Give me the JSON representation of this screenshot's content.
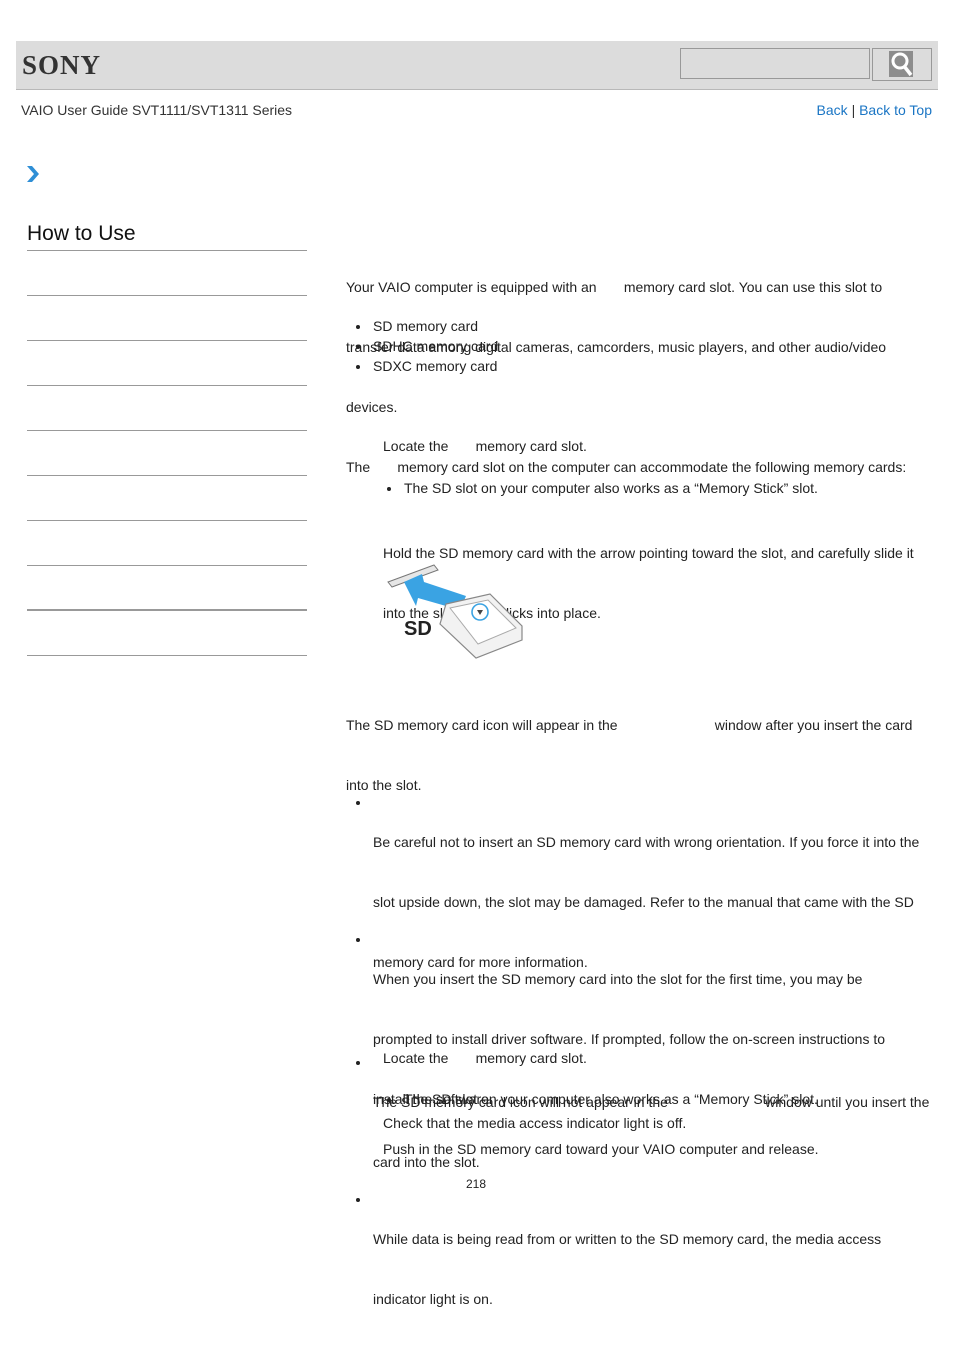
{
  "header": {
    "logo": "SONY",
    "search_placeholder": "",
    "search_icon": "search-icon"
  },
  "subheader": {
    "title": "VAIO User Guide SVT1111/SVT1311 Series",
    "back_label": "Back",
    "separator": "|",
    "back_to_top_label": "Back to Top"
  },
  "breadcrumb": {
    "icon": "chevron-right-icon"
  },
  "sidebar": {
    "heading": "How to Use",
    "items": [
      "",
      "",
      "",
      "",
      "",
      "",
      "",
      "",
      ""
    ]
  },
  "content": {
    "intro_line1": "Your VAIO computer is equipped with an       memory card slot. You can use this slot to",
    "intro_line2": "transfer data among digital cameras, camcorders, music players, and other audio/video",
    "intro_line3": "devices.",
    "slot_line": "The       memory card slot on the computer can accommodate the following memory cards:",
    "card_types": [
      "SD memory card",
      "SDHC memory card",
      "SDXC memory card"
    ],
    "insert_steps": {
      "step1": "Locate the       memory card slot.",
      "step1_note": "The SD slot on your computer also works as a “Memory Stick” slot.",
      "step2_line1": "Hold the SD memory card with the arrow pointing toward the slot, and carefully slide it",
      "step2_line2": "into the slot until it clicks into place.",
      "illustration_label": "SD",
      "step3_line1": "The SD memory card icon will appear in the                         window after you insert the card",
      "step3_line2": "into the slot."
    },
    "notes": [
      [
        "Be careful not to insert an SD memory card with wrong orientation. If you force it into the",
        "slot upside down, the slot may be damaged. Refer to the manual that came with the SD",
        "memory card for more information."
      ],
      [
        "The SD memory card icon will not appear in the                         window until you insert the",
        "card into the slot."
      ]
    ],
    "hints": [
      [
        "When you insert the SD memory card into the slot for the first time, you may be",
        "prompted to install driver software. If prompted, follow the on-screen instructions to",
        "install the software."
      ],
      [
        "While data is being read from or written to the SD memory card, the media access",
        "indicator light is on."
      ]
    ],
    "remove_steps": {
      "step1": "Locate the       memory card slot.",
      "step1_note": "The SD slot on your computer also works as a “Memory Stick” slot.",
      "step2": "Check that the media access indicator light is off.",
      "step3": "Push in the SD memory card toward your VAIO computer and release."
    }
  },
  "page_number": "218",
  "colors": {
    "link": "#1a75c4",
    "header_bg": "#dcdcdc",
    "arrow_accent": "#3aa3e3"
  }
}
